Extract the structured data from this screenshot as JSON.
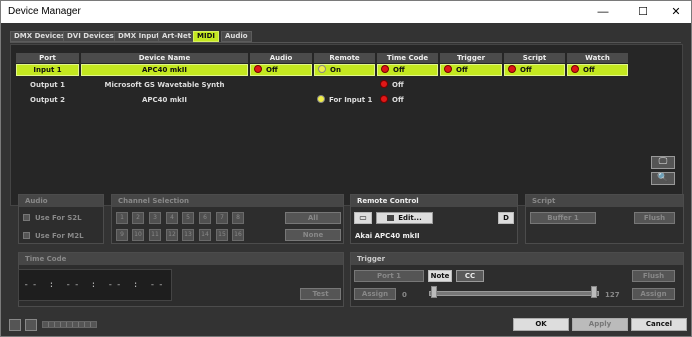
{
  "window": {
    "title": "Device Manager",
    "minimize": "—",
    "maximize": "☐",
    "close": "✕"
  },
  "tabs": [
    "DMX Devices",
    "DVI Devices",
    "DMX Input",
    "Art-Net",
    "MIDI",
    "Audio"
  ],
  "active_tab": "MIDI",
  "columns": [
    "Port",
    "Device Name",
    "Audio",
    "Remote",
    "Time Code",
    "Trigger",
    "Script",
    "Watch"
  ],
  "rows": [
    {
      "port": "Input 1",
      "device": "APC40 mkII",
      "audio": "Off",
      "remote": "On",
      "timecode": "Off",
      "trigger": "Off",
      "script": "Off",
      "watch": "Off"
    },
    {
      "port": "Output 1",
      "device": "Microsoft GS Wavetable Synth",
      "timecode": "Off"
    },
    {
      "port": "Output 2",
      "device": "APC40 mkII",
      "remote": "For Input 1",
      "timecode": "Off"
    }
  ],
  "side_buttons": {
    "monitor": "🖵",
    "search": "🔍"
  },
  "audio_panel": {
    "title": "Audio",
    "use_s2l": "Use For S2L",
    "use_m2l": "Use For M2L"
  },
  "channel_panel": {
    "title": "Channel Selection",
    "channels": [
      "1",
      "2",
      "3",
      "4",
      "5",
      "6",
      "7",
      "8",
      "9",
      "10",
      "11",
      "12",
      "13",
      "14",
      "15",
      "16"
    ],
    "all": "All",
    "none": "None"
  },
  "remote_panel": {
    "title": "Remote Control",
    "edit": "Edit...",
    "d": "D",
    "device": "Akai APC40 mkII"
  },
  "script_panel": {
    "title": "Script",
    "buffer": "Buffer 1",
    "flush": "Flush"
  },
  "timecode_panel": {
    "title": "Time Code",
    "display": "-- : -- : -- : --",
    "test": "Test"
  },
  "trigger_panel": {
    "title": "Trigger",
    "port": "Port 1",
    "note": "Note",
    "cc": "CC",
    "flush": "Flush",
    "assign": "Assign",
    "min": "0",
    "max": "127"
  },
  "footer": {
    "ok": "OK",
    "apply": "Apply",
    "cancel": "Cancel"
  },
  "colors": {
    "accent": "#c4e820",
    "active_dot": "#e01818",
    "remote_dot": "#f0ee4a"
  }
}
